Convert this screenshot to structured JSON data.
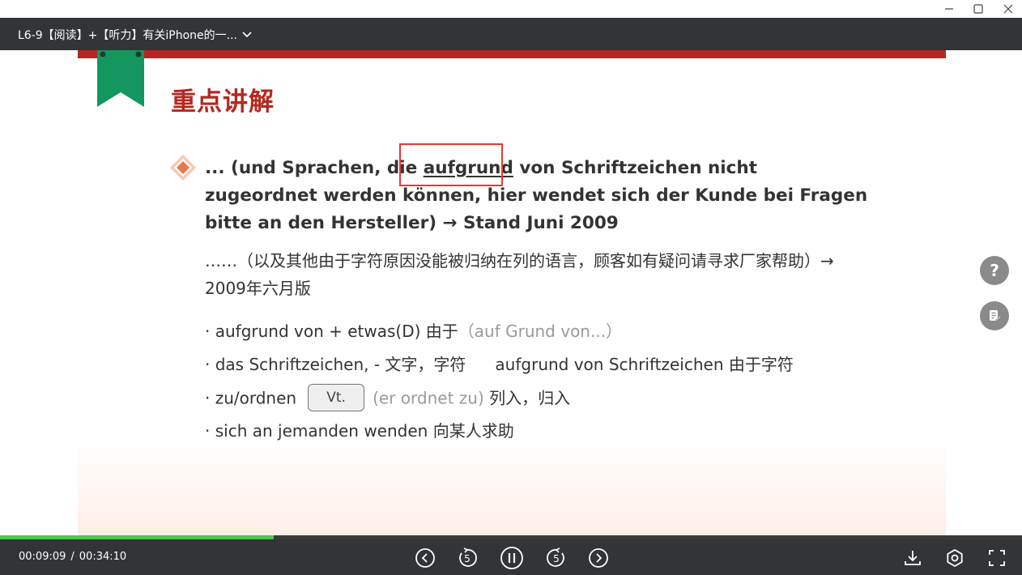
{
  "window": {
    "minimize_icon": "minimize-icon",
    "maximize_icon": "maximize-icon",
    "close_icon": "close-icon"
  },
  "header": {
    "title": "L6-9【阅读】+【听力】有关iPhone的一...",
    "dropdown_icon": "chevron-down-icon"
  },
  "slide": {
    "title": "重点讲解",
    "de_paragraph": {
      "before": "... (und Sprachen, die ",
      "keyword": "aufgrund",
      "after": " von Schriftzeichen nicht zugeordnet werden können, hier wendet sich der Kunde bei Fragen bitte an den Hersteller) → Stand Juni 2009"
    },
    "zh_paragraph": "……（以及其他由于字符原因没能被归纳在列的语言，顾客如有疑问请寻求厂家帮助）→ 2009年六月版",
    "vocab": [
      {
        "text": "· aufgrund von + etwas(D) 由于",
        "note": "（auf Grund von...）"
      },
      {
        "text": "· das Schriftzeichen, - 文字，字符",
        "extra": "aufgrund von Schriftzeichen 由于字符"
      },
      {
        "text": "· zu/ordnen",
        "badge": "Vt.",
        "note": "(er ordnet zu)",
        "meaning": " 列入，归入"
      },
      {
        "text": "· sich an jemanden wenden 向某人求助"
      }
    ],
    "colors": {
      "accent_red": "#b3281e",
      "bookmark_green": "#14975f",
      "highlight_red": "#e53935"
    }
  },
  "side_buttons": {
    "help_label": "?",
    "help_icon": "question-icon",
    "note_icon": "note-edit-icon"
  },
  "player": {
    "current_time": "00:09:09",
    "separator": "/",
    "total_time": "00:34:10",
    "progress": 0.268,
    "progress_color": "#4cc754",
    "icons": [
      "previous-icon",
      "rewind-5-icon",
      "pause-icon",
      "forward-5-icon",
      "next-icon",
      "download-icon",
      "settings-icon",
      "fullscreen-icon"
    ]
  }
}
